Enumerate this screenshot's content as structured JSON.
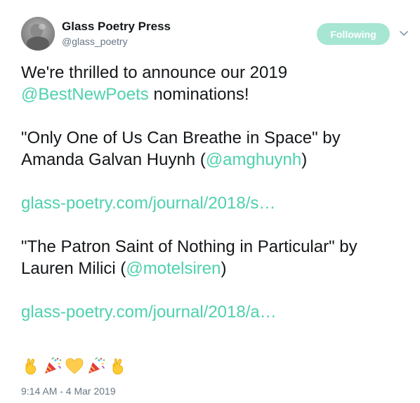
{
  "account": {
    "display_name": "Glass Poetry Press",
    "screen_name": "@glass_poetry"
  },
  "follow_button": {
    "label": "Following"
  },
  "tweet": {
    "line1": "We're thrilled to announce our 2019",
    "mention_best_new_poets": "@BestNewPoets",
    "line2_suffix": " nominations!",
    "poem1_title": "\"Only One of Us Can Breathe in Space\" by",
    "poem1_author": "Amanda Galvan Huynh (",
    "poem1_handle": "@amghuynh",
    "poem1_close": ")",
    "poem1_link": "glass-poetry.com/journal/2018/s…",
    "poem2_title": "\"The Patron Saint of Nothing in Particular\" by",
    "poem2_author": "Lauren Milici (",
    "poem2_handle": "@motelsiren",
    "poem2_close": ")",
    "poem2_link": "glass-poetry.com/journal/2018/a…"
  },
  "emojis": [
    "crossed-fingers",
    "party-popper",
    "yellow-heart",
    "party-popper",
    "crossed-fingers"
  ],
  "timestamp": "9:14 AM - 4 Mar 2019",
  "colors": {
    "link": "#4fd1ae",
    "follow_button_bg": "#a6e6d3",
    "secondary_text": "#657786",
    "primary_text": "#14171a"
  }
}
